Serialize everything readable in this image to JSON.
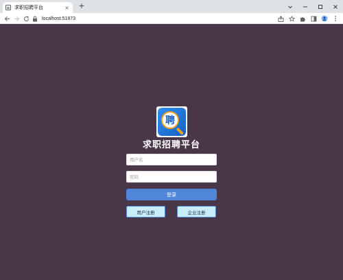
{
  "browser": {
    "tab_title": "求职招聘平台",
    "tab_close": "×",
    "new_tab": "+",
    "url": "localhost:51873",
    "window_controls": [
      "chevron-down-icon",
      "minimize-icon",
      "maximize-icon",
      "close-icon"
    ],
    "toolbar_icons": [
      "share-icon",
      "star-icon",
      "extensions-icon",
      "sidebar-icon",
      "profile-icon",
      "menu-icon"
    ]
  },
  "login": {
    "logo_char": "聘",
    "title": "求职招聘平台",
    "username_placeholder": "用户名",
    "password_placeholder": "密码",
    "login_label": "登录",
    "user_register_label": "用户注册",
    "company_register_label": "企业注册"
  },
  "colors": {
    "page_background": "#4a3649",
    "primary_button": "#4f86d8",
    "register_button": "#c7ecfb"
  }
}
